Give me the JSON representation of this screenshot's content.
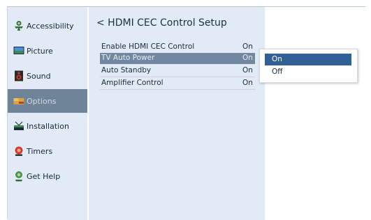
{
  "sidebar": {
    "items": [
      {
        "label": "Accessibility",
        "icon": "accessibility-icon",
        "selected": false
      },
      {
        "label": "Picture",
        "icon": "picture-icon",
        "selected": false
      },
      {
        "label": "Sound",
        "icon": "sound-icon",
        "selected": false
      },
      {
        "label": "Options",
        "icon": "options-icon",
        "selected": true
      },
      {
        "label": "Installation",
        "icon": "installation-icon",
        "selected": false
      },
      {
        "label": "Timers",
        "icon": "timers-icon",
        "selected": false
      },
      {
        "label": "Get Help",
        "icon": "get-help-icon",
        "selected": false
      }
    ]
  },
  "panel": {
    "title": "< HDMI CEC Control Setup",
    "rows": [
      {
        "label": "Enable HDMI CEC Control",
        "value": "On"
      },
      {
        "label": "TV Auto Power",
        "value": "On"
      },
      {
        "label": "Auto Standby",
        "value": "On"
      },
      {
        "label": "Amplifier Control",
        "value": "On"
      }
    ]
  },
  "popup": {
    "options": [
      "On",
      "Off"
    ],
    "selected": "On"
  },
  "colors": {
    "panel_bg": "#e1eaf5",
    "selected_sidebar": "#6f8499",
    "highlight_row": "#7188a0",
    "popup_selected": "#2f6196"
  }
}
